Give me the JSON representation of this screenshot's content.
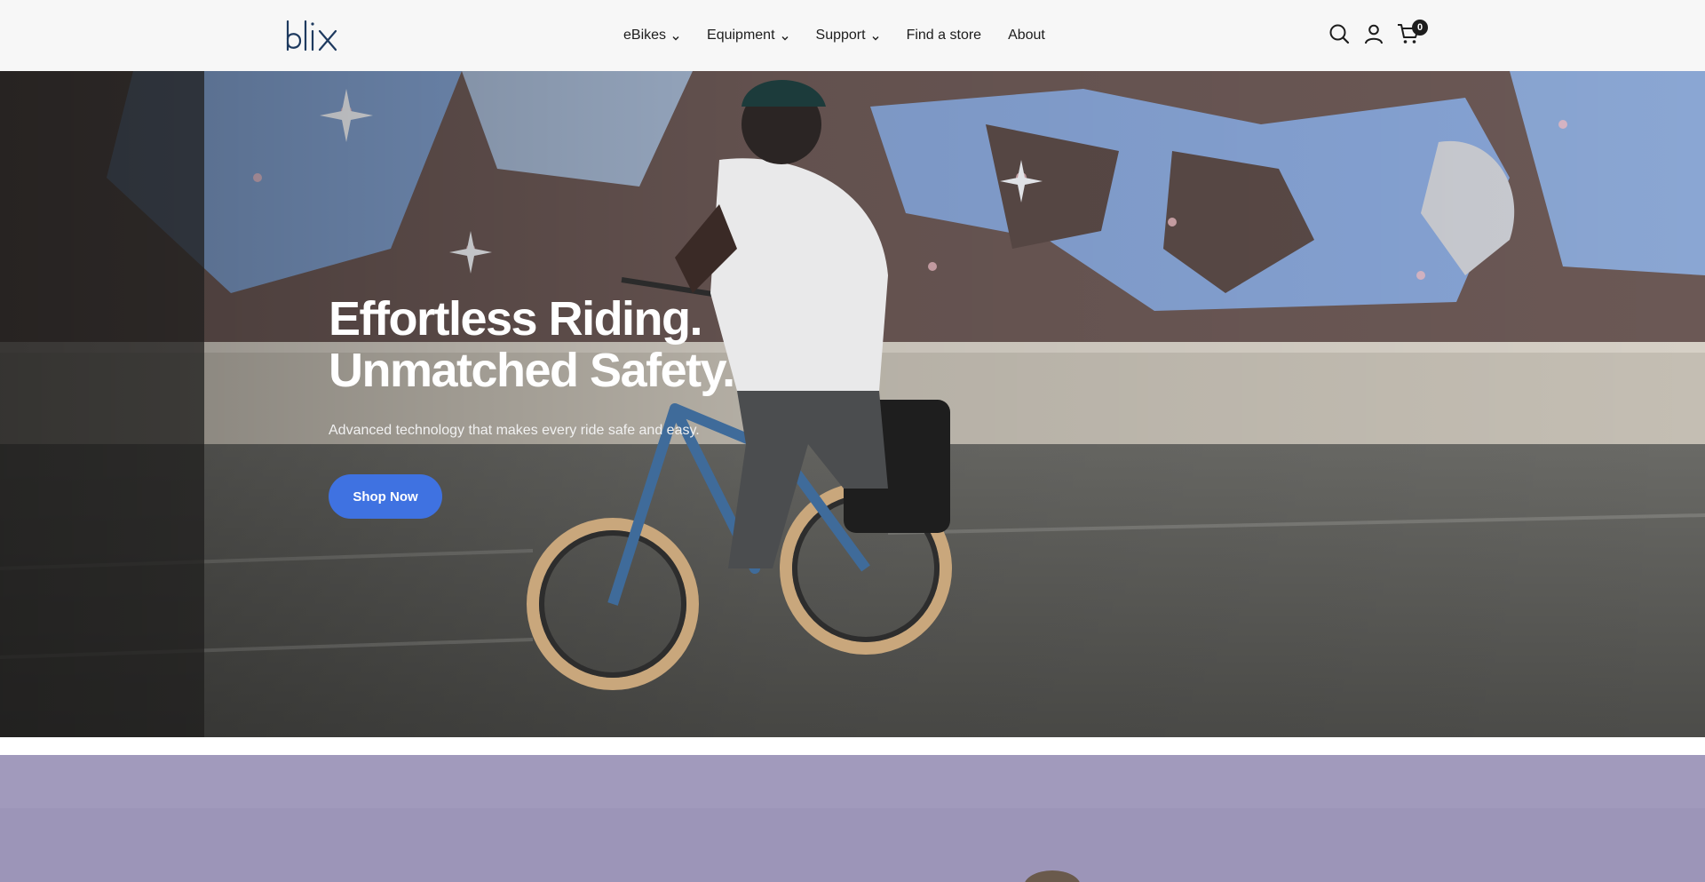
{
  "brand": {
    "logo_text": "blix",
    "logo_color": "#1e3a5f"
  },
  "nav": {
    "items": [
      {
        "label": "eBikes",
        "has_dropdown": true
      },
      {
        "label": "Equipment",
        "has_dropdown": true
      },
      {
        "label": "Support",
        "has_dropdown": true
      },
      {
        "label": "Find a store",
        "has_dropdown": false
      },
      {
        "label": "About",
        "has_dropdown": false
      }
    ]
  },
  "header_icons": {
    "search": "search-icon",
    "account": "user-icon",
    "cart": "cart-icon",
    "cart_count": "0"
  },
  "hero": {
    "title_line1": "Effortless Riding.",
    "title_line2": "Unmatched Safety.",
    "subtitle": "Advanced technology that makes every ride safe and easy.",
    "cta_label": "Shop Now",
    "cta_color": "#3f72e1"
  }
}
